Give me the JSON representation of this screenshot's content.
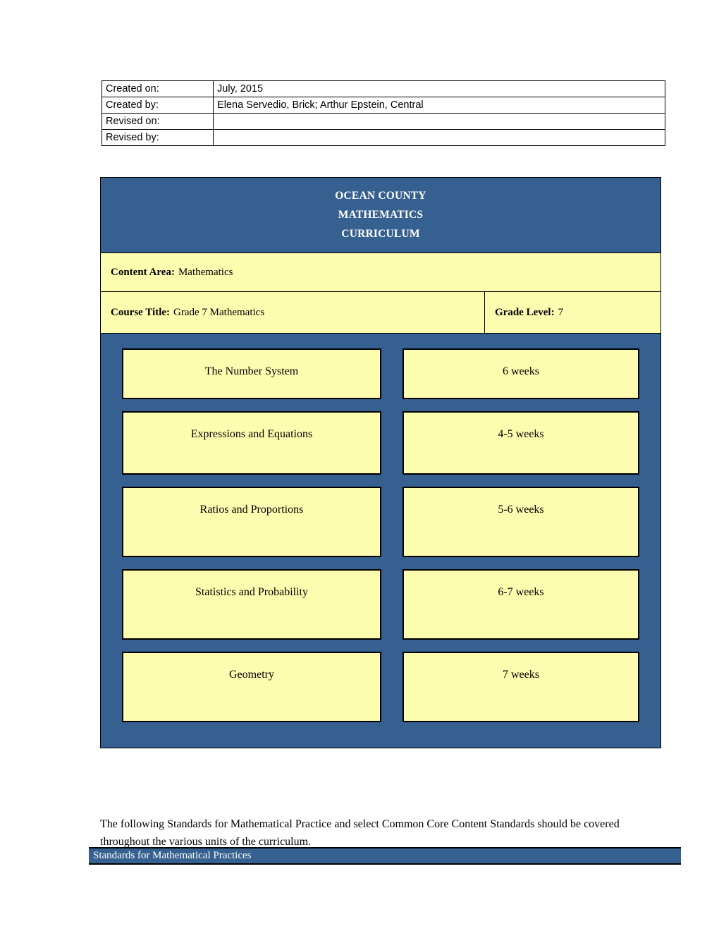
{
  "metadata_table": {
    "rows": [
      {
        "label": "Created on:",
        "value": "July, 2015"
      },
      {
        "label": "Created by:",
        "value": "Elena Servedio, Brick; Arthur Epstein, Central"
      },
      {
        "label": "Revised on:",
        "value": ""
      },
      {
        "label": "Revised by:",
        "value": ""
      }
    ]
  },
  "curriculum_card": {
    "title_lines": [
      "OCEAN COUNTY",
      "MATHEMATICS",
      "CURRICULUM"
    ],
    "content_area": {
      "label": "Content Area:",
      "value": "Mathematics"
    },
    "course_title": {
      "label": "Course Title:",
      "value": "Grade 7 Mathematics"
    },
    "grade_level": {
      "label": "Grade Level:",
      "value": "7"
    },
    "units": [
      {
        "name": "The Number System",
        "duration": "6 weeks"
      },
      {
        "name": "Expressions and Equations",
        "duration": "4-5 weeks"
      },
      {
        "name": "Ratios and Proportions",
        "duration": "5-6 weeks"
      },
      {
        "name": "Statistics and Probability",
        "duration": "6-7 weeks"
      },
      {
        "name": "Geometry",
        "duration": "7 weeks"
      }
    ]
  },
  "standards_note": "The following Standards for Mathematical Practice and select Common Core Content Standards should be covered throughout the various units of the curriculum.",
  "standards_bar": {
    "label": "Standards for Mathematical Practices"
  },
  "colors": {
    "header_blue": "#36608f",
    "cell_yellow": "#fdfdb0",
    "border_black": "#000000",
    "text_white": "#ffffff"
  }
}
